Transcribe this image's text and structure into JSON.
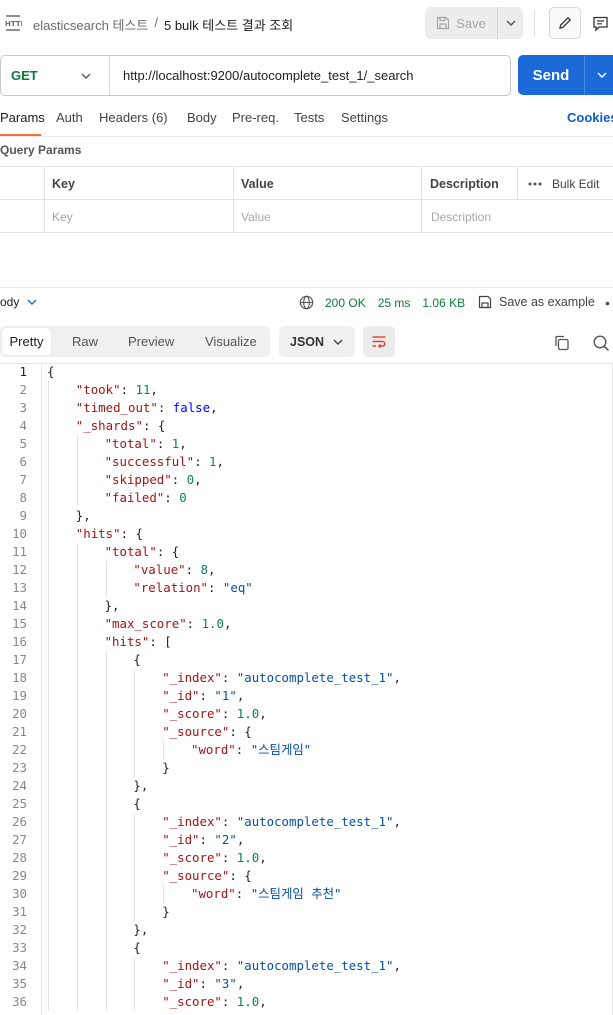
{
  "header": {
    "breadcrumb_parent": "elasticsearch 테스트",
    "breadcrumb_sep": "/",
    "breadcrumb_current": "5 bulk 테스트 결과 조회",
    "save_label": "Save"
  },
  "request": {
    "method": "GET",
    "url": "http://localhost:9200/autocomplete_test_1/_search",
    "send_label": "Send"
  },
  "tabs": {
    "items": [
      "Params",
      "Auth",
      "Headers (6)",
      "Body",
      "Pre-req.",
      "Tests",
      "Settings"
    ],
    "active": "Params",
    "cookies_label": "Cookies"
  },
  "query_params": {
    "title": "Query Params",
    "columns": [
      "Key",
      "Value",
      "Description"
    ],
    "placeholders": [
      "Key",
      "Value",
      "Description"
    ],
    "bulk_edit_label": "Bulk Edit"
  },
  "response": {
    "body_label": "ody",
    "status": "200 OK",
    "time": "25 ms",
    "size": "1.06 KB",
    "save_example_label": "Save as example",
    "view_options": [
      "Pretty",
      "Raw",
      "Preview",
      "Visualize"
    ],
    "active_view": "Pretty",
    "format": "JSON"
  },
  "code": {
    "line_numbers": [
      "1",
      "2",
      "3",
      "4",
      "5",
      "6",
      "7",
      "8",
      "9",
      "10",
      "11",
      "12",
      "13",
      "14",
      "15",
      "16",
      "17",
      "18",
      "19",
      "20",
      "21",
      "22",
      "23",
      "24",
      "25",
      "26",
      "27",
      "28",
      "29",
      "30",
      "31",
      "32",
      "33",
      "34",
      "35",
      "36"
    ],
    "lines": [
      [
        [
          "p",
          "{"
        ]
      ],
      [
        [
          "k",
          "\"took\""
        ],
        [
          "p",
          ": "
        ],
        [
          "n",
          "11"
        ],
        [
          "p",
          ","
        ]
      ],
      [
        [
          "k",
          "\"timed_out\""
        ],
        [
          "p",
          ": "
        ],
        [
          "w",
          "false"
        ],
        [
          "p",
          ","
        ]
      ],
      [
        [
          "k",
          "\"_shards\""
        ],
        [
          "p",
          ": {"
        ]
      ],
      [
        [
          "k",
          "\"total\""
        ],
        [
          "p",
          ": "
        ],
        [
          "n",
          "1"
        ],
        [
          "p",
          ","
        ]
      ],
      [
        [
          "k",
          "\"successful\""
        ],
        [
          "p",
          ": "
        ],
        [
          "n",
          "1"
        ],
        [
          "p",
          ","
        ]
      ],
      [
        [
          "k",
          "\"skipped\""
        ],
        [
          "p",
          ": "
        ],
        [
          "n",
          "0"
        ],
        [
          "p",
          ","
        ]
      ],
      [
        [
          "k",
          "\"failed\""
        ],
        [
          "p",
          ": "
        ],
        [
          "n",
          "0"
        ]
      ],
      [
        [
          "p",
          "},"
        ]
      ],
      [
        [
          "k",
          "\"hits\""
        ],
        [
          "p",
          ": {"
        ]
      ],
      [
        [
          "k",
          "\"total\""
        ],
        [
          "p",
          ": {"
        ]
      ],
      [
        [
          "k",
          "\"value\""
        ],
        [
          "p",
          ": "
        ],
        [
          "n",
          "8"
        ],
        [
          "p",
          ","
        ]
      ],
      [
        [
          "k",
          "\"relation\""
        ],
        [
          "p",
          ": "
        ],
        [
          "s",
          "\"eq\""
        ]
      ],
      [
        [
          "p",
          "},"
        ]
      ],
      [
        [
          "k",
          "\"max_score\""
        ],
        [
          "p",
          ": "
        ],
        [
          "n",
          "1.0"
        ],
        [
          "p",
          ","
        ]
      ],
      [
        [
          "k",
          "\"hits\""
        ],
        [
          "p",
          ": ["
        ]
      ],
      [
        [
          "p",
          "{"
        ]
      ],
      [
        [
          "k",
          "\"_index\""
        ],
        [
          "p",
          ": "
        ],
        [
          "s",
          "\"autocomplete_test_1\""
        ],
        [
          "p",
          ","
        ]
      ],
      [
        [
          "k",
          "\"_id\""
        ],
        [
          "p",
          ": "
        ],
        [
          "s",
          "\"1\""
        ],
        [
          "p",
          ","
        ]
      ],
      [
        [
          "k",
          "\"_score\""
        ],
        [
          "p",
          ": "
        ],
        [
          "n",
          "1.0"
        ],
        [
          "p",
          ","
        ]
      ],
      [
        [
          "k",
          "\"_source\""
        ],
        [
          "p",
          ": {"
        ]
      ],
      [
        [
          "k",
          "\"word\""
        ],
        [
          "p",
          ": "
        ],
        [
          "s",
          "\"스팀게임\""
        ]
      ],
      [
        [
          "p",
          "}"
        ]
      ],
      [
        [
          "p",
          "},"
        ]
      ],
      [
        [
          "p",
          "{"
        ]
      ],
      [
        [
          "k",
          "\"_index\""
        ],
        [
          "p",
          ": "
        ],
        [
          "s",
          "\"autocomplete_test_1\""
        ],
        [
          "p",
          ","
        ]
      ],
      [
        [
          "k",
          "\"_id\""
        ],
        [
          "p",
          ": "
        ],
        [
          "s",
          "\"2\""
        ],
        [
          "p",
          ","
        ]
      ],
      [
        [
          "k",
          "\"_score\""
        ],
        [
          "p",
          ": "
        ],
        [
          "n",
          "1.0"
        ],
        [
          "p",
          ","
        ]
      ],
      [
        [
          "k",
          "\"_source\""
        ],
        [
          "p",
          ": {"
        ]
      ],
      [
        [
          "k",
          "\"word\""
        ],
        [
          "p",
          ": "
        ],
        [
          "s",
          "\"스팀게임 추천\""
        ]
      ],
      [
        [
          "p",
          "}"
        ]
      ],
      [
        [
          "p",
          "},"
        ]
      ],
      [
        [
          "p",
          "{"
        ]
      ],
      [
        [
          "k",
          "\"_index\""
        ],
        [
          "p",
          ": "
        ],
        [
          "s",
          "\"autocomplete_test_1\""
        ],
        [
          "p",
          ","
        ]
      ],
      [
        [
          "k",
          "\"_id\""
        ],
        [
          "p",
          ": "
        ],
        [
          "s",
          "\"3\""
        ],
        [
          "p",
          ","
        ]
      ],
      [
        [
          "k",
          "\"_score\""
        ],
        [
          "p",
          ": "
        ],
        [
          "n",
          "1.0"
        ],
        [
          "p",
          ","
        ]
      ]
    ],
    "indents": [
      0,
      1,
      1,
      1,
      2,
      2,
      2,
      2,
      1,
      1,
      2,
      3,
      3,
      2,
      2,
      2,
      3,
      4,
      4,
      4,
      4,
      5,
      4,
      3,
      3,
      4,
      4,
      4,
      4,
      5,
      4,
      3,
      3,
      4,
      4,
      4
    ]
  }
}
